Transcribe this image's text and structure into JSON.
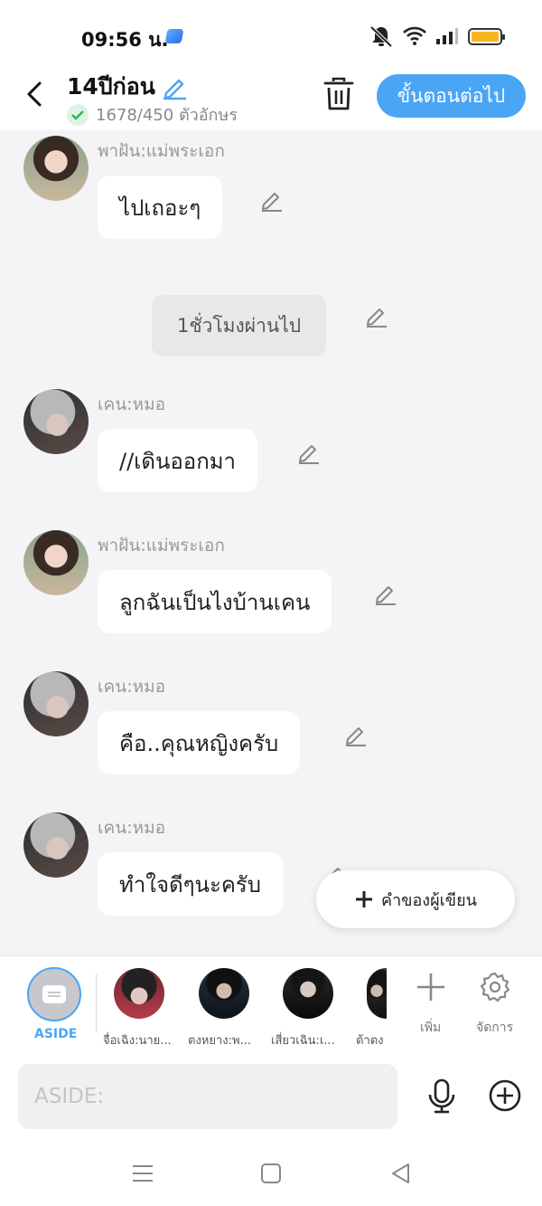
{
  "status": {
    "time": "09:56 น."
  },
  "header": {
    "title": "14ปีก่อน",
    "char_count": "1678/450 ตัวอักษร",
    "next_label": "ขั้นตอนต่อไป"
  },
  "messages": [
    {
      "speaker": "พาฝัน:แม่พระเอก",
      "text": "ไปเถอะๆ"
    },
    {
      "narration": "1ชั่วโมงผ่านไป"
    },
    {
      "speaker": "เคน:หมอ",
      "text": "//เดินออกมา"
    },
    {
      "speaker": "พาฝัน:แม่พระเอก",
      "text": "ลูกฉันเป็นไงบ้านเคน"
    },
    {
      "speaker": "เคน:หมอ",
      "text": "คือ..คุณหญิงครับ"
    },
    {
      "speaker": "เคน:หมอ",
      "text": "ทำใจดีๆนะครับ"
    }
  ],
  "author_button": "คำของผู้เขียน",
  "character_bar": {
    "aside": "ASIDE",
    "characters": [
      "จื่อเฉิง:นาย...",
      "ตงหยาง:พ...",
      "เสี่ยวเฉิน:เ...",
      "ต้าตง"
    ],
    "add": "เพิ่ม",
    "manage": "จัดการ"
  },
  "input": {
    "placeholder": "ASIDE:"
  },
  "colors": {
    "accent": "#4aa5f5",
    "background": "#f4f4f6",
    "bubble": "#ffffff"
  }
}
